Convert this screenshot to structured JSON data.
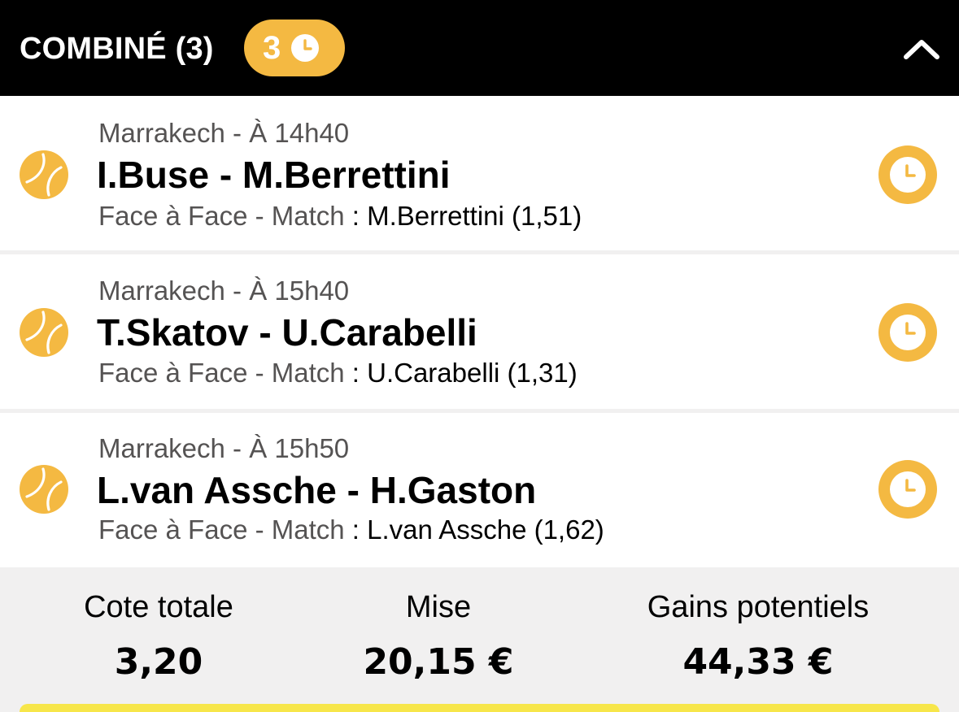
{
  "header": {
    "title": "COMBINÉ (3)",
    "pending_count": "3",
    "icons": {
      "pending": "clock-icon",
      "collapse": "chevron-up-icon"
    }
  },
  "colors": {
    "header_bg": "#000000",
    "accent": "#f4b942",
    "summary_bg": "#f1f0f0",
    "cta": "#f7e64a",
    "muted_text": "#555353"
  },
  "bets": [
    {
      "event": "Marrakech - À 14h40",
      "match": "I.Buse - M.Berrettini",
      "market": "Face à Face - Match",
      "separator": " : ",
      "selection": "M.Berrettini (1,51)",
      "sport_icon": "tennis-ball-icon",
      "status_icon": "clock-icon"
    },
    {
      "event": "Marrakech - À 15h40",
      "match": "T.Skatov - U.Carabelli",
      "market": "Face à Face - Match",
      "separator": " : ",
      "selection": "U.Carabelli (1,31)",
      "sport_icon": "tennis-ball-icon",
      "status_icon": "clock-icon"
    },
    {
      "event": "Marrakech - À 15h50",
      "match": "L.van Assche - H.Gaston",
      "market": "Face à Face - Match",
      "separator": " : ",
      "selection": "L.van Assche (1,62)",
      "sport_icon": "tennis-ball-icon",
      "status_icon": "clock-icon"
    }
  ],
  "summary": {
    "total_odds_label": "Cote totale",
    "total_odds_value": "3,20",
    "stake_label": "Mise",
    "stake_value": "20,15 €",
    "potential_win_label": "Gains potentiels",
    "potential_win_value": "44,33 €"
  }
}
